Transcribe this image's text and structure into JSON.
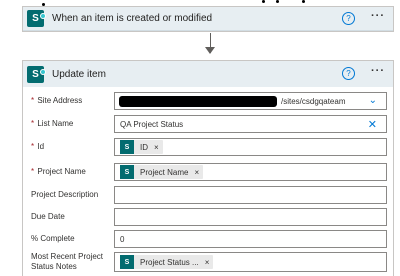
{
  "trigger": {
    "title": "When an item is created or modified",
    "help_glyph": "?",
    "more_glyph": "···"
  },
  "action": {
    "title": "Update item",
    "help_glyph": "?",
    "more_glyph": "···",
    "fields": {
      "site_address": {
        "label": "Site Address",
        "required": "*",
        "value": "/sites/csdgqateam"
      },
      "list_name": {
        "label": "List Name",
        "required": "*",
        "value": "QA Project Status"
      },
      "id": {
        "label": "Id",
        "required": "*",
        "token": "ID"
      },
      "project_name": {
        "label": "Project Name",
        "required": "*",
        "token": "Project Name"
      },
      "project_description": {
        "label": "Project Description",
        "value": ""
      },
      "due_date": {
        "label": "Due Date",
        "value": ""
      },
      "percent_complete": {
        "label": "% Complete",
        "value": "0"
      },
      "status_notes": {
        "label": "Most Recent Project Status Notes",
        "token": "Project Status ..."
      }
    }
  },
  "icons": {
    "app_icon": "sharepoint-icon",
    "token_icon": "sharepoint-icon",
    "remove_icon": "close-icon",
    "dropdown_icon": "chevron-down-icon"
  },
  "colors": {
    "header_bg": "#e7eef2",
    "sharepoint_teal": "#036c70",
    "accent_blue": "#0078d4",
    "required_red": "#a4262c"
  }
}
